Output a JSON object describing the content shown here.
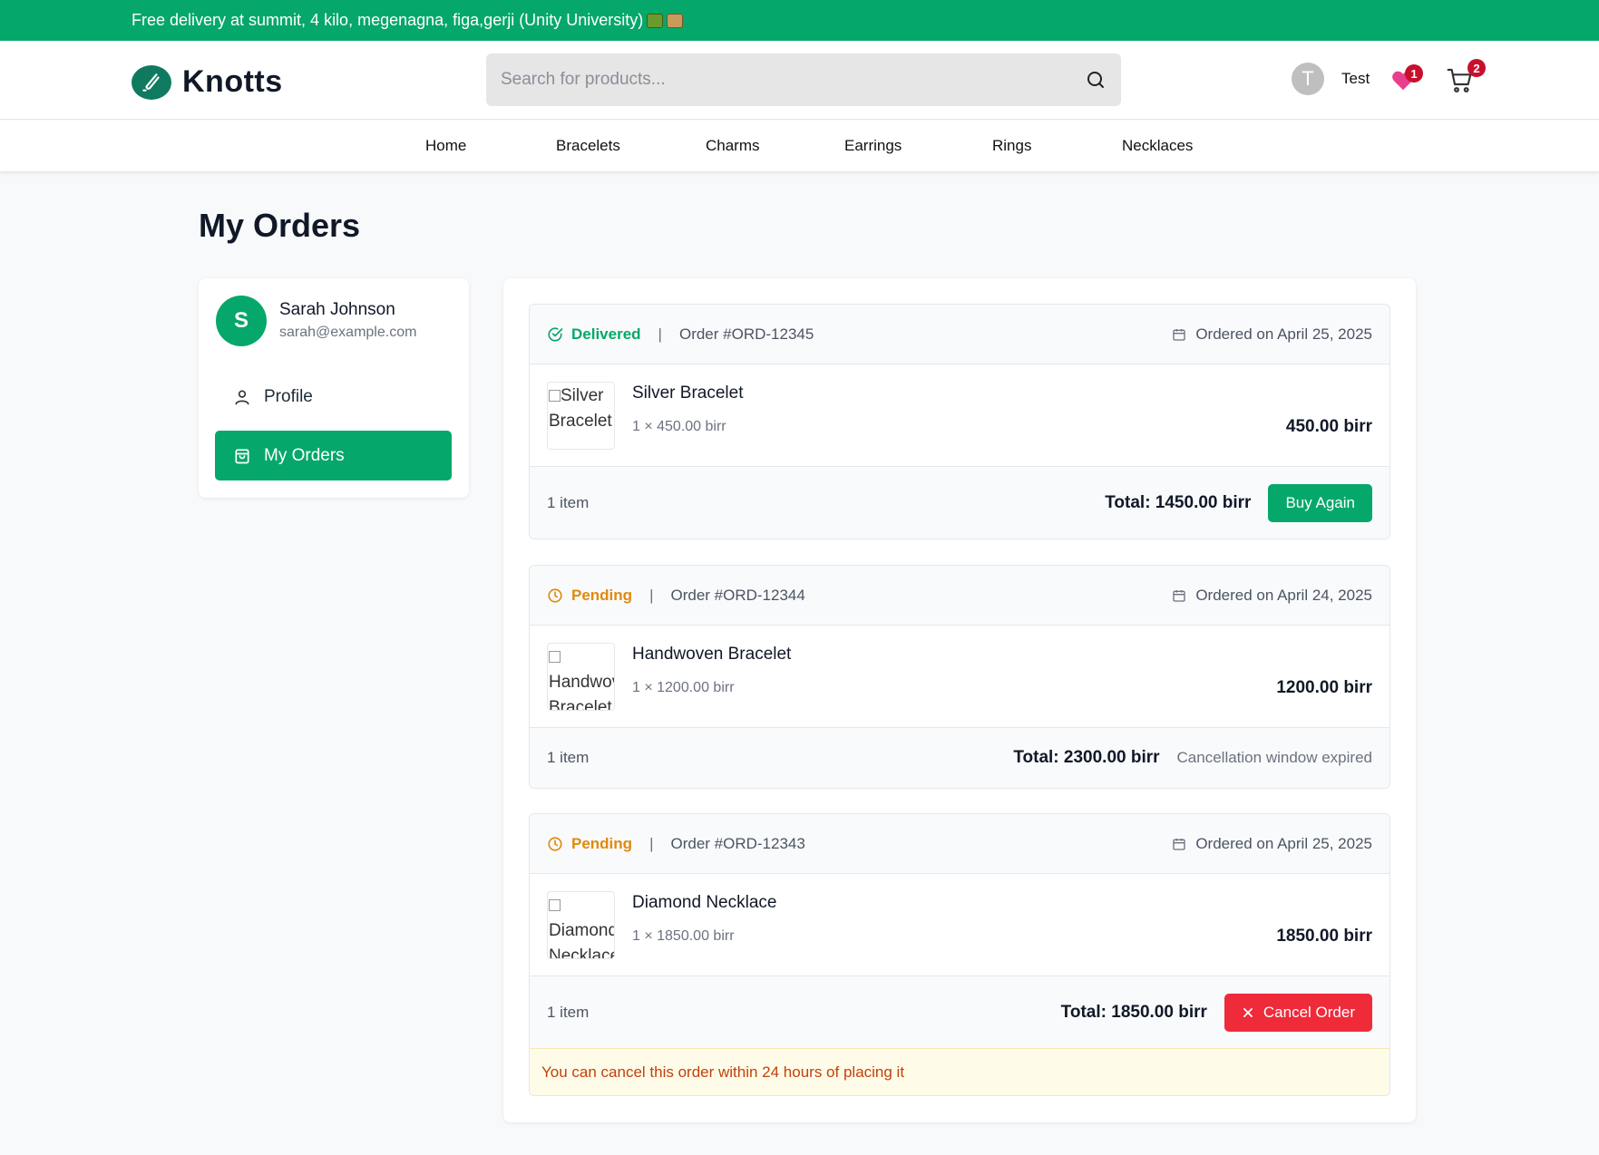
{
  "promo": {
    "text": "Free delivery at summit, 4 kilo, megenagna, figa,gerji (Unity University)",
    "emoji": [
      "delivery-truck-emoji",
      "package-emoji"
    ]
  },
  "header": {
    "brand": "Knotts",
    "search_placeholder": "Search for products...",
    "user_initial": "T",
    "user_name": "Test",
    "wishlist_count": "1",
    "cart_count": "2"
  },
  "nav": {
    "items": [
      "Home",
      "Bracelets",
      "Charms",
      "Earrings",
      "Rings",
      "Necklaces"
    ]
  },
  "page": {
    "title": "My Orders"
  },
  "sidebar": {
    "avatar_initial": "S",
    "name": "Sarah Johnson",
    "email": "sarah@example.com",
    "items": [
      {
        "label": "Profile",
        "icon": "user-icon",
        "active": false
      },
      {
        "label": "My Orders",
        "icon": "shopping-bag-icon",
        "active": true
      }
    ]
  },
  "orders": [
    {
      "status": "Delivered",
      "status_color": "#05a86a",
      "order_id": "Order #ORD-12345",
      "date": "Ordered on April 25, 2025",
      "item": {
        "image_alt": "Silver Bracelet",
        "name": "Silver Bracelet",
        "qty": "1 × 450.00 birr",
        "price": "450.00 birr"
      },
      "count": "1 item",
      "total": "Total: 1450.00 birr",
      "action": "Buy Again"
    },
    {
      "status": "Pending",
      "status_color": "#e08a0e",
      "order_id": "Order #ORD-12344",
      "date": "Ordered on April 24, 2025",
      "item": {
        "image_alt": "Handwoven Bracelet",
        "name": "Handwoven Bracelet",
        "qty": "1 × 1200.00 birr",
        "price": "1200.00 birr"
      },
      "count": "1 item",
      "total": "Total: 2300.00 birr",
      "note": "Cancellation window expired"
    },
    {
      "status": "Pending",
      "status_color": "#e08a0e",
      "order_id": "Order #ORD-12343",
      "date": "Ordered on April 25, 2025",
      "item": {
        "image_alt": "Diamond Necklace",
        "name": "Diamond Necklace",
        "qty": "1 × 1850.00 birr",
        "price": "1850.00 birr"
      },
      "count": "1 item",
      "total": "Total: 1850.00 birr",
      "action": "Cancel Order",
      "warning": "You can cancel this order within 24 hours of placing it"
    }
  ],
  "colors": {
    "brand_green": "#05a86a",
    "danger_red": "#ef2b3a",
    "pending_amber": "#e08a0e"
  }
}
